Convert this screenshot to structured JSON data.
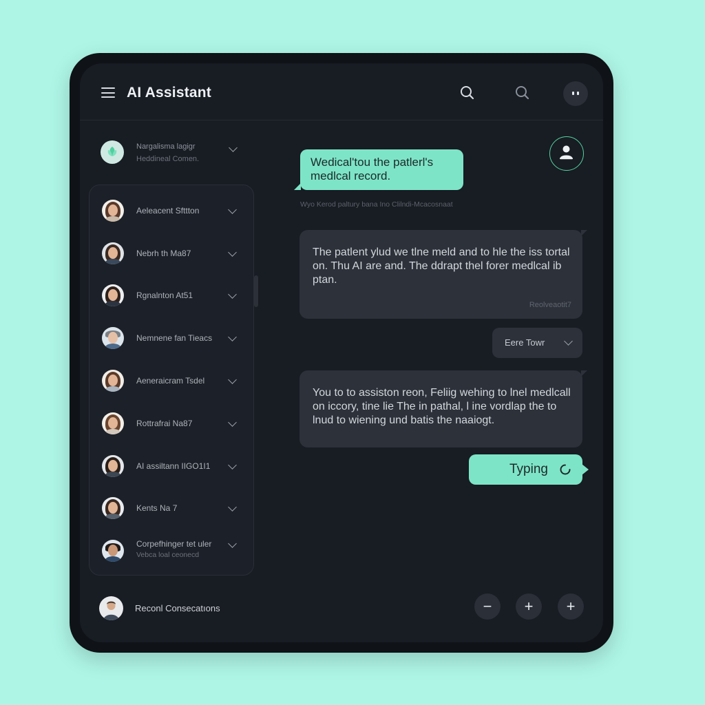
{
  "header": {
    "title": "AI Assistant"
  },
  "sidebar": {
    "top_item": {
      "name": "Nargalisma lagigr",
      "sub": "Heddineal Comen."
    },
    "contacts": [
      {
        "name": "Aeleacent Sfttton",
        "sub": ""
      },
      {
        "name": "Nebrh th Ma87",
        "sub": ""
      },
      {
        "name": "Rgnalnton At51",
        "sub": ""
      },
      {
        "name": "Nemnene fan Tieacs",
        "sub": ""
      },
      {
        "name": "Aeneraicram Tsdel",
        "sub": ""
      },
      {
        "name": "Rottrafrai Na87",
        "sub": ""
      },
      {
        "name": "AI assiltann IIGO1I1",
        "sub": ""
      },
      {
        "name": "Kents Na 7",
        "sub": ""
      },
      {
        "name": "Corpefhinger tet uler",
        "sub": "Vebca loal ceonecd"
      }
    ]
  },
  "chat": {
    "user_message": "Wedical'tou the patlerl's medlcal record.",
    "caption": "Wyo Kerod paltury bana Ino Clilndi-Mcacosnaat",
    "ai_message_1": "The patlent ylud we tlne meld and to hle the iss tortal on. Thu AI are and. The ddrapt thel forer medlcal ib ptan.",
    "ai_message_1_meta": "Reolveaotit7",
    "dropdown_label": "Eere Towr",
    "ai_message_2": "You to to assiston reon, Feliig wehing to lnel medlcall on iccory, tine lie The in pathal, l ine vordlap the to lnud to wiening und batis the naaiogt.",
    "typing_label": "Typing"
  },
  "footer": {
    "label": "Reconl Consecatıons",
    "buttons": [
      "−",
      "+",
      "+"
    ]
  },
  "colors": {
    "background": "#aef5e6",
    "accent": "#7ee4c8",
    "panel": "#181c23",
    "bubble": "#2c313a"
  }
}
